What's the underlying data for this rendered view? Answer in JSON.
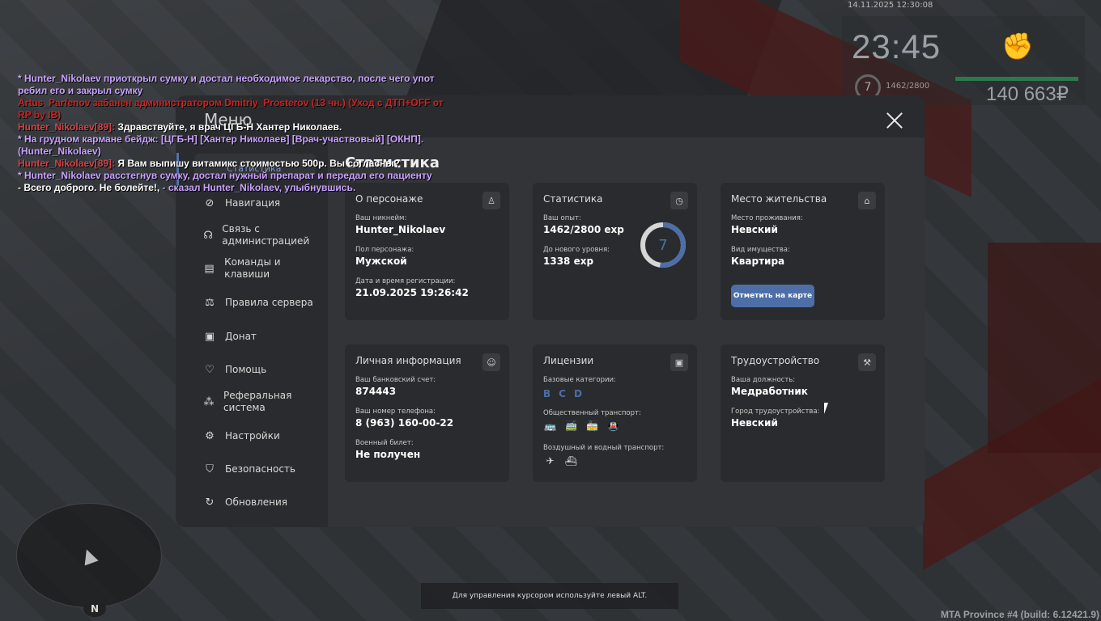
{
  "hud": {
    "datetime": "14.11.2025 12:30:08",
    "clock": "23:45",
    "level": "7",
    "exp": "1462/2800",
    "money": "140 663₽",
    "build": "MTA Province #4 (build: 6.12421.9)"
  },
  "chat": [
    {
      "cls": "me",
      "text": "* Hunter_Nikolaev приоткрыл сумку и достал необходимое лекарство, после чего упот"
    },
    {
      "cls": "me",
      "text": "ребил его и закрыл сумку"
    },
    {
      "cls": "red",
      "text": "Artus_Parfenov забанен администратором Dmitriy_Prosterov (13 чн.) (Уход с ДТП+OFF от"
    },
    {
      "cls": "red",
      "text": " RP by IB)"
    },
    {
      "cls": "nick",
      "text": "Hunter_Nikolaev[89]:",
      "rest": " Здравствуйте, я врач ЦГБ-Н Хантер Николаев."
    },
    {
      "cls": "me",
      "text": "* На грудном кармане бейдж: [ЦГБ-Н] [Хантер Николаев] [Врач-участвовый] [ОКНП]."
    },
    {
      "cls": "me",
      "text": "(Hunter_Nikolaev)"
    },
    {
      "cls": "nick",
      "text": "Hunter_Nikolaev[89]:",
      "rest": " Я Вам выпишу витамикс стоимостью 500р. Вы согласны?"
    },
    {
      "cls": "me",
      "text": "* Hunter_Nikolaev расстегнув сумку, достал нужный препарат и передал его пациенту"
    },
    {
      "cls": "white",
      "text": "- Всего доброго. Не болейте!,",
      "rest2": " - сказал Hunter_Nikolaev, улыбнувшись."
    }
  ],
  "menu": {
    "title": "Меню",
    "section_title": "Статистика",
    "active_tab": "Статистика",
    "nav": [
      {
        "label": "Навигация",
        "icon": "compass-icon"
      },
      {
        "label": "Связь с администрацией",
        "icon": "headset-icon"
      },
      {
        "label": "Команды и клавиши",
        "icon": "document-icon"
      },
      {
        "label": "Правила сервера",
        "icon": "scales-icon"
      },
      {
        "label": "Донат",
        "icon": "wallet-icon"
      },
      {
        "label": "Помощь",
        "icon": "heart-hand-icon"
      },
      {
        "label": "Реферальная система",
        "icon": "network-icon"
      },
      {
        "label": "Настройки",
        "icon": "gear-icon"
      },
      {
        "label": "Безопасность",
        "icon": "shield-icon"
      },
      {
        "label": "Обновления",
        "icon": "update-icon"
      }
    ]
  },
  "cards": {
    "character": {
      "title": "О персонаже",
      "nick_label": "Ваш никнейм:",
      "nick": "Hunter_Nikolaev",
      "gender_label": "Пол персонажа:",
      "gender": "Мужской",
      "reg_label": "Дата и время регистрации:",
      "reg": "21.09.2025 19:26:42"
    },
    "stats": {
      "title": "Статистика",
      "exp_label": "Ваш опыт:",
      "exp": "1462/2800 exp",
      "next_label": "До нового уровня:",
      "next": "1338 exp",
      "level": "7",
      "progress": 0.522
    },
    "residence": {
      "title": "Место жительства",
      "place_label": "Место проживания:",
      "place": "Невский",
      "type_label": "Вид имущества:",
      "type": "Квартира",
      "button": "Отметить на карте"
    },
    "personal": {
      "title": "Личная информация",
      "bank_label": "Ваш банковский счет:",
      "bank": "874443",
      "phone_label": "Ваш номер телефона:",
      "phone": "8 (963) 160-00-22",
      "military_label": "Военный билет:",
      "military": "Не получен"
    },
    "licenses": {
      "title": "Лицензии",
      "base_label": "Базовые категории:",
      "cat_b": "B",
      "cat_c": "C",
      "cat_d": "D",
      "public_label": "Общественный транспорт:",
      "air_label": "Воздушный и водный транспорт:"
    },
    "job": {
      "title": "Трудоустройство",
      "pos_label": "Ваша должность:",
      "pos": "Медработник",
      "city_label": "Город трудоустройства:",
      "city": "Невский"
    }
  },
  "hint": "Для управления курсором используйте левый ALT.",
  "minimap_north": "N",
  "colors": {
    "accent": "#4d6ea7",
    "panel": "#2a2b2e",
    "content": "#333437"
  }
}
